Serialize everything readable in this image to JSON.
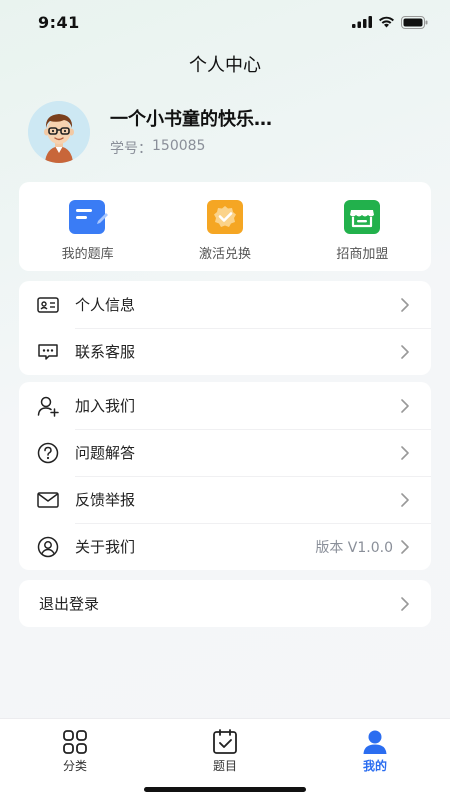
{
  "status": {
    "time": "9:41"
  },
  "header": {
    "title": "个人中心"
  },
  "profile": {
    "name": "一个小书童的快乐…",
    "id_label": "学号：",
    "id_value": "150085"
  },
  "quick_actions": [
    {
      "label": "我的题库",
      "icon": "question-bank-icon",
      "color": "#3a7cf5"
    },
    {
      "label": "激活兑换",
      "icon": "redeem-badge-icon",
      "color": "#f5a623"
    },
    {
      "label": "招商加盟",
      "icon": "store-icon",
      "color": "#22b14c"
    }
  ],
  "menu_group1": [
    {
      "label": "个人信息",
      "icon": "id-card-icon"
    },
    {
      "label": "联系客服",
      "icon": "chat-bubble-icon"
    }
  ],
  "menu_group2": [
    {
      "label": "加入我们",
      "icon": "add-user-icon"
    },
    {
      "label": "问题解答",
      "icon": "question-circle-icon"
    },
    {
      "label": "反馈举报",
      "icon": "mail-icon"
    },
    {
      "label": "关于我们",
      "icon": "user-circle-icon",
      "value": "版本 V1.0.0"
    }
  ],
  "logout": {
    "label": "退出登录"
  },
  "tabs": [
    {
      "label": "分类",
      "icon": "grid-icon"
    },
    {
      "label": "题目",
      "icon": "checklist-icon"
    },
    {
      "label": "我的",
      "icon": "person-icon",
      "active": true
    }
  ],
  "colors": {
    "accent": "#2b6df0"
  }
}
